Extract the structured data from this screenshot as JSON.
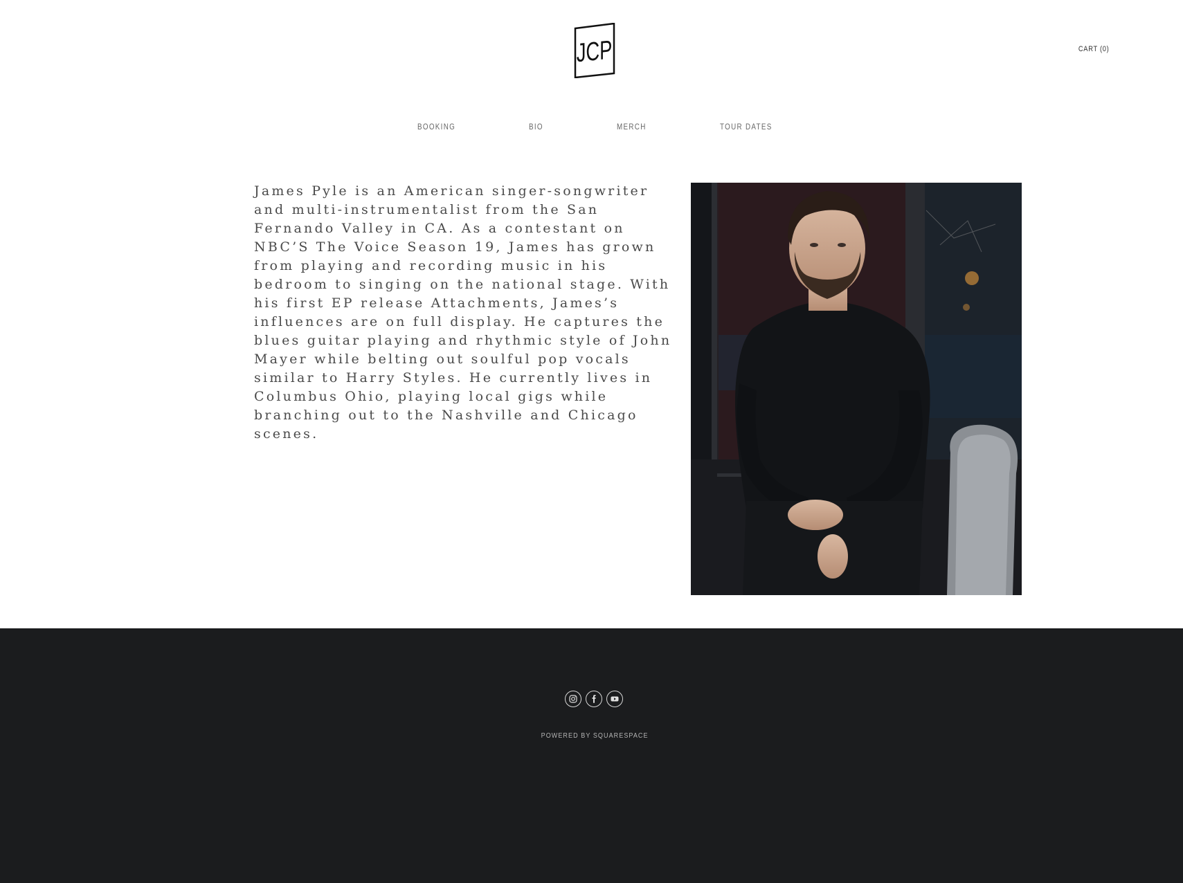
{
  "header": {
    "logo_text": "JCP",
    "cart_label": "CART (0)"
  },
  "nav": {
    "items": [
      {
        "label": "BOOKING"
      },
      {
        "label": "BIO"
      },
      {
        "label": "MERCH"
      },
      {
        "label": "TOUR DATES"
      }
    ]
  },
  "bio": {
    "lines": [
      "James Pyle is an American singer-songwriter",
      "and multi-instrumentalist from the San",
      "Fernando Valley in CA. As a contestant on",
      "NBC’S The Voice Season 19, James has grown",
      "from playing and recording music in his",
      "bedroom to singing on the national stage. With",
      "his first EP release Attachments, James’s",
      "influences are on full display. He captures the",
      "blues guitar playing and rhythmic style of John",
      "Mayer while belting out soulful pop vocals",
      "similar to Harry Styles. He currently lives in",
      "Columbus Ohio, playing local gigs while",
      "branching out  to the Nashville and Chicago",
      "scenes."
    ]
  },
  "photo": {
    "subject": "portrait of bearded man in black sweater leaning against dark doorway beside guitar case"
  },
  "footer": {
    "social": [
      {
        "icon": "instagram-icon"
      },
      {
        "icon": "facebook-icon"
      },
      {
        "icon": "youtube-icon"
      }
    ],
    "powered_by": "POWERED BY SQUARESPACE"
  },
  "colors": {
    "footer_bg": "#1b1c1e",
    "text": "#4a4a4a",
    "nav_text": "#666666"
  }
}
